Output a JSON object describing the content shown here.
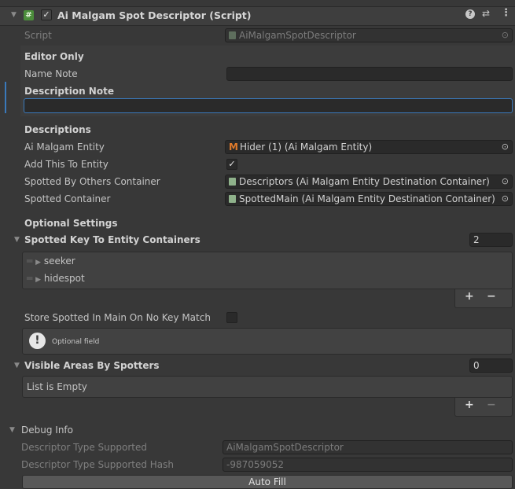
{
  "header": {
    "title": "Ai Malgam Spot Descriptor (Script)",
    "help_icon": "help-icon",
    "preset_icon": "preset-icon",
    "menu_icon": "kebab-menu-icon"
  },
  "script_row": {
    "label": "Script",
    "value": "AiMalgamSpotDescriptor"
  },
  "editor_only": {
    "heading": "Editor Only",
    "name_note_label": "Name Note",
    "name_note_value": "",
    "description_note_label": "Description Note",
    "description_note_value": ""
  },
  "descriptions": {
    "heading": "Descriptions",
    "entity_label": "Ai Malgam Entity",
    "entity_value": "Hider (1) (Ai Malgam Entity)",
    "add_label": "Add This To Entity",
    "add_checked": "✓",
    "spotted_by_label": "Spotted By Others Container",
    "spotted_by_value": "Descriptors (Ai Malgam Entity Destination Container)",
    "spotted_label": "Spotted Container",
    "spotted_value": "SpottedMain (Ai Malgam Entity Destination Container)"
  },
  "optional": {
    "heading": "Optional Settings",
    "key_list_label": "Spotted Key To Entity Containers",
    "key_list_count": "2",
    "key_items": [
      "seeker",
      "hidespot"
    ],
    "store_label": "Store Spotted In Main On No Key Match",
    "help_text": "Optional field",
    "areas_label": "Visible Areas By Spotters",
    "areas_count": "0",
    "areas_empty": "List is Empty",
    "add_symbol": "+",
    "remove_symbol": "−"
  },
  "debug": {
    "heading": "Debug Info",
    "type_label": "Descriptor Type Supported",
    "type_value": "AiMalgamSpotDescriptor",
    "hash_label": "Descriptor Type Supported Hash",
    "hash_value": "-987059052",
    "autofill_label": "Auto Fill"
  },
  "colors": {
    "accent": "#3a79bb",
    "background": "#383838",
    "field": "#2a2a2a"
  }
}
